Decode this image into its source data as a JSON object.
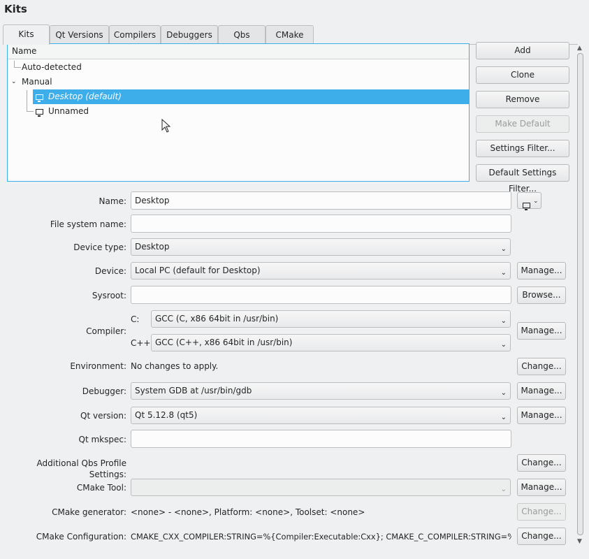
{
  "page_title": "Kits",
  "tabs": [
    "Kits",
    "Qt Versions",
    "Compilers",
    "Debuggers",
    "Qbs",
    "CMake"
  ],
  "tree": {
    "header": "Name",
    "auto_detected": "Auto-detected",
    "manual": "Manual",
    "items": [
      "Desktop (default)",
      "Unnamed"
    ]
  },
  "side_buttons": {
    "add": "Add",
    "clone": "Clone",
    "remove": "Remove",
    "make_default": "Make Default",
    "settings_filter": "Settings Filter...",
    "default_settings_filter": "Default Settings Filter..."
  },
  "form": {
    "name_label": "Name:",
    "name_value": "Desktop",
    "fs_name_label": "File system name:",
    "fs_name_value": "",
    "device_type_label": "Device type:",
    "device_type_value": "Desktop",
    "device_label": "Device:",
    "device_value": "Local PC (default for Desktop)",
    "device_manage": "Manage...",
    "sysroot_label": "Sysroot:",
    "sysroot_value": "",
    "sysroot_browse": "Browse...",
    "compiler_label": "Compiler:",
    "c_label": "C:",
    "c_value": "GCC (C, x86 64bit in /usr/bin)",
    "cxx_label": "C++:",
    "cxx_value": "GCC (C++, x86 64bit in /usr/bin)",
    "compiler_manage": "Manage...",
    "environment_label": "Environment:",
    "environment_value": "No changes to apply.",
    "environment_change": "Change...",
    "debugger_label": "Debugger:",
    "debugger_value": "System GDB at /usr/bin/gdb",
    "debugger_manage": "Manage...",
    "qt_version_label": "Qt version:",
    "qt_version_value": "Qt 5.12.8 (qt5)",
    "qt_version_manage": "Manage...",
    "qt_mkspec_label": "Qt mkspec:",
    "qt_mkspec_value": "",
    "qbs_label": "Additional Qbs Profile Settings:",
    "qbs_change": "Change...",
    "cmake_tool_label": "CMake Tool:",
    "cmake_tool_value": "",
    "cmake_tool_manage": "Manage...",
    "cmake_gen_label": "CMake generator:",
    "cmake_gen_value": "<none> - <none>, Platform: <none>, Toolset: <none>",
    "cmake_gen_change": "Change...",
    "cmake_config_label": "CMake Configuration:",
    "cmake_config_value": "CMAKE_CXX_COMPILER:STRING=%{Compiler:Executable:Cxx}; CMAKE_C_COMPILER:STRING=%{Com...",
    "cmake_config_change": "Change..."
  },
  "icons": {
    "kit_icon": "monitor-icon",
    "expand": "chevron-down-icon"
  }
}
